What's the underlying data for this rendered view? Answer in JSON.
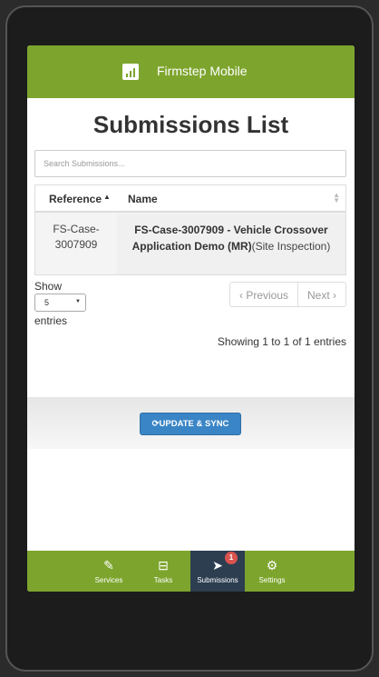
{
  "app": {
    "title": "Firmstep Mobile"
  },
  "page": {
    "title": "Submissions List"
  },
  "search": {
    "placeholder": "Search Submissions..."
  },
  "table": {
    "columns": [
      "Reference",
      "Name"
    ],
    "rows": [
      {
        "reference_line1": "FS-Case-",
        "reference_line2": "3007909",
        "name_bold": "FS-Case-3007909 - Vehicle Crossover Application Demo (MR)",
        "name_rest": "(Site Inspection)"
      }
    ]
  },
  "length": {
    "show_label": "Show",
    "value": "5",
    "entries_label": "entries"
  },
  "pager": {
    "previous": "Previous",
    "next": "Next"
  },
  "info": "Showing 1 to 1 of 1 entries",
  "sync": {
    "label": "UPDATE & SYNC"
  },
  "tabs": [
    {
      "label": "Services",
      "icon": "edit-icon"
    },
    {
      "label": "Tasks",
      "icon": "inbox-icon"
    },
    {
      "label": "Submissions",
      "icon": "send-icon",
      "badge": "1"
    },
    {
      "label": "Settings",
      "icon": "gear-icon"
    }
  ],
  "colors": {
    "brand": "#7da52d",
    "active_tab": "#2c3e50",
    "sync_button": "#3a85c6",
    "badge": "#d9534f"
  }
}
